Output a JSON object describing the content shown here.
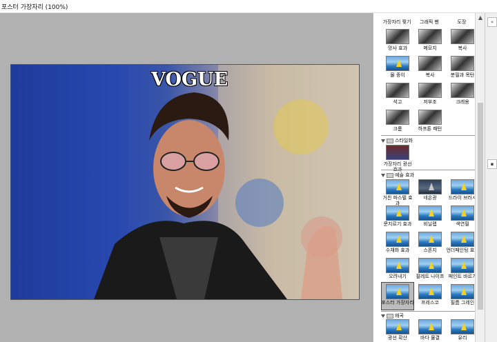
{
  "window": {
    "title": "포스터 가장자리 (100%)"
  },
  "preview": {
    "logo_text": "VOGUE"
  },
  "filters": {
    "row0": [
      "가장자리 찢기",
      "그래픽 펜",
      "도장"
    ],
    "row1": [
      "망사 효과",
      "메모지",
      "복사"
    ],
    "row2": [
      "물 종이",
      "복사",
      "분필과 목탄"
    ],
    "row3": [
      "석고",
      "저부조",
      "크레용"
    ],
    "row4": [
      "크롬",
      "하프톤 패턴"
    ],
    "category_stylize": "스타일화",
    "stylize_items": [
      "가장자리 광선 효과"
    ],
    "category_artistic": "예술 효과",
    "artistic": [
      "거친 파스텔 효과",
      "네온광",
      "드라이 브러시",
      "문지르기 효과",
      "비닐랩",
      "색연필",
      "수채화 효과",
      "스폰지",
      "언더페인팅 효과",
      "오려내기",
      "팔레트 나이프",
      "페인트 바르기",
      "포스터 가장자리",
      "프레스코",
      "필름 그레인"
    ],
    "category_distort": "왜곡",
    "distort": [
      "광선 확산",
      "바다 물결",
      "유리"
    ]
  },
  "selected_filter": "포스터 가장자리",
  "colors": {
    "canvas_bg": "#b1b1b1",
    "panel_bg": "#ffffff",
    "selected": "#bcbcbc"
  }
}
